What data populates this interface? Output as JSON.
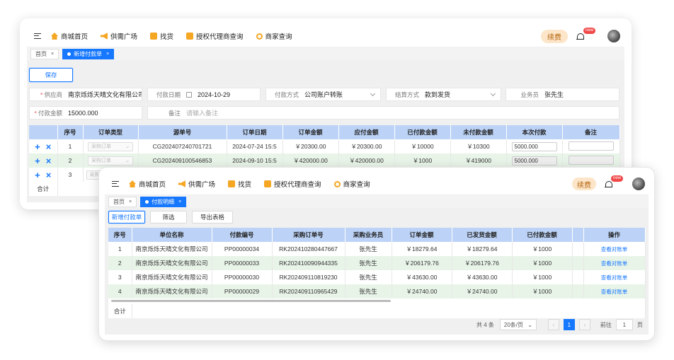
{
  "nav": [
    "商城首页",
    "供需广场",
    "找货",
    "授权代理商查询",
    "商家查询"
  ],
  "renew_label": "续费",
  "new_badge": "new",
  "window1": {
    "tabs": [
      {
        "label": "首页",
        "active": false
      },
      {
        "label": "新增付款单",
        "active": true
      }
    ],
    "save_label": "保存",
    "form": {
      "supplier_label": "供应商",
      "supplier_value": "南京烁烁天晴文化有限公司",
      "pay_date_label": "付款日期",
      "pay_date_value": "2024-10-29",
      "pay_method_label": "付款方式",
      "pay_method_value": "公司账户转账",
      "settle_label": "结算方式",
      "settle_value": "款到发货",
      "staff_label": "业务员",
      "staff_value": "张先生",
      "amount_label": "付款金额",
      "amount_value": "15000.000",
      "remark_label": "备注",
      "remark_placeholder": "请输入备注"
    },
    "columns": [
      "序号",
      "订单类型",
      "源单号",
      "订单日期",
      "订单金额",
      "应付金额",
      "已付款金额",
      "未付款金额",
      "本次付款",
      "备注"
    ],
    "rows": [
      {
        "no": "1",
        "type": "采购订单",
        "src": "CG202407240701721",
        "date": "2024-07-24 15:5",
        "amount": "￥20300.00",
        "payable": "￥20300.00",
        "paid": "￥10000",
        "unpaid": "￥10300",
        "this_pay": "5000.000"
      },
      {
        "no": "2",
        "type": "采购订单",
        "src": "CG202409100546853",
        "date": "2024-09-10 15:5",
        "amount": "￥420000.00",
        "payable": "￥420000.00",
        "paid": "￥1000",
        "unpaid": "￥419000",
        "this_pay": "5000.000"
      },
      {
        "no": "3",
        "type": "采购",
        "src": "",
        "date": "",
        "amount": "",
        "payable": "",
        "paid": "",
        "unpaid": "",
        "this_pay": ""
      }
    ],
    "total_label": "合计"
  },
  "window2": {
    "tabs": [
      {
        "label": "首页",
        "active": false
      },
      {
        "label": "付款明细",
        "active": true
      }
    ],
    "buttons": [
      "新增付款单",
      "筛选",
      "导出表格"
    ],
    "columns": [
      "序号",
      "单位名称",
      "付款编号",
      "采购订单号",
      "采购业务员",
      "订单金额",
      "已发货金额",
      "已付款金额",
      "",
      "操作"
    ],
    "rows": [
      {
        "no": "1",
        "company": "南京烁烁天晴文化有限公司",
        "pay_no": "PP00000034",
        "po": "RK202410280447667",
        "staff": "张先生",
        "amount": "￥18279.64",
        "shipped": "￥18279.64",
        "paid": "￥1000",
        "op": "查看对账单"
      },
      {
        "no": "2",
        "company": "南京烁烁天晴文化有限公司",
        "pay_no": "PP00000033",
        "po": "RK202410090944335",
        "staff": "张先生",
        "amount": "￥206179.76",
        "shipped": "￥206179.76",
        "paid": "￥1000",
        "op": "查看对账单"
      },
      {
        "no": "3",
        "company": "南京烁烁天晴文化有限公司",
        "pay_no": "PP00000030",
        "po": "RK202409110819230",
        "staff": "张先生",
        "amount": "￥43630.00",
        "shipped": "￥43630.00",
        "paid": "￥1000",
        "op": "查看对账单"
      },
      {
        "no": "4",
        "company": "南京烁烁天晴文化有限公司",
        "pay_no": "PP00000029",
        "po": "RK202409110965429",
        "staff": "张先生",
        "amount": "￥24740.00",
        "shipped": "￥24740.00",
        "paid": "￥1000",
        "op": "查看对账单"
      }
    ],
    "total_label": "合计",
    "pager": {
      "total": "共 4 条",
      "size": "20条/页",
      "current": "1",
      "goto_label": "前往",
      "goto_value": "1",
      "page_unit": "页"
    }
  }
}
